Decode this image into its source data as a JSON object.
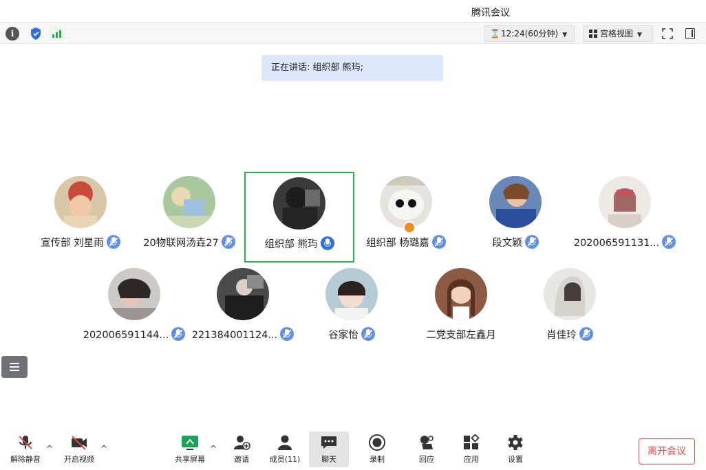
{
  "window": {
    "title": "腾讯会议"
  },
  "topbar": {
    "timer": "12:24(60分钟)",
    "view_mode": "宫格视图",
    "icons": [
      "info-icon",
      "shield-icon",
      "signal-icon",
      "fullscreen-icon",
      "sidebar-icon"
    ]
  },
  "speaking_banner": "正在讲话: 组织部 熊玙;",
  "participants": [
    {
      "name": "宣传部 刘星雨",
      "mic": "muted",
      "active_speaker": false
    },
    {
      "name": "20物联网汤垚27",
      "mic": "muted",
      "active_speaker": false
    },
    {
      "name": "组织部 熊玙",
      "mic": "on",
      "active_speaker": true
    },
    {
      "name": "组织部 杨璐嘉",
      "mic": "muted",
      "active_speaker": false,
      "badge": "host"
    },
    {
      "name": "段文颖",
      "mic": "muted",
      "active_speaker": false
    },
    {
      "name": "202006591131...",
      "mic": "muted",
      "active_speaker": false
    },
    {
      "name": "202006591144...",
      "mic": "muted",
      "active_speaker": false
    },
    {
      "name": "221384001124...",
      "mic": "muted",
      "active_speaker": false
    },
    {
      "name": "谷家怡",
      "mic": "muted",
      "active_speaker": false
    },
    {
      "name": "二党支部左鑫月",
      "mic": "none",
      "active_speaker": false
    },
    {
      "name": "肖佳玲",
      "mic": "muted",
      "active_speaker": false
    }
  ],
  "toolbar": {
    "unmute": "解除静音",
    "start_video": "开启视频",
    "share_screen": "共享屏幕",
    "invite": "邀请",
    "members": "成员(11)",
    "chat": "聊天",
    "record": "录制",
    "reactions": "回应",
    "apps": "应用",
    "settings": "设置",
    "leave": "离开会议"
  },
  "colors": {
    "accent_blue": "#2f6fe0",
    "active_border": "#22b14c",
    "leave_red": "#e54545",
    "banner_bg": "#dde9fb"
  }
}
